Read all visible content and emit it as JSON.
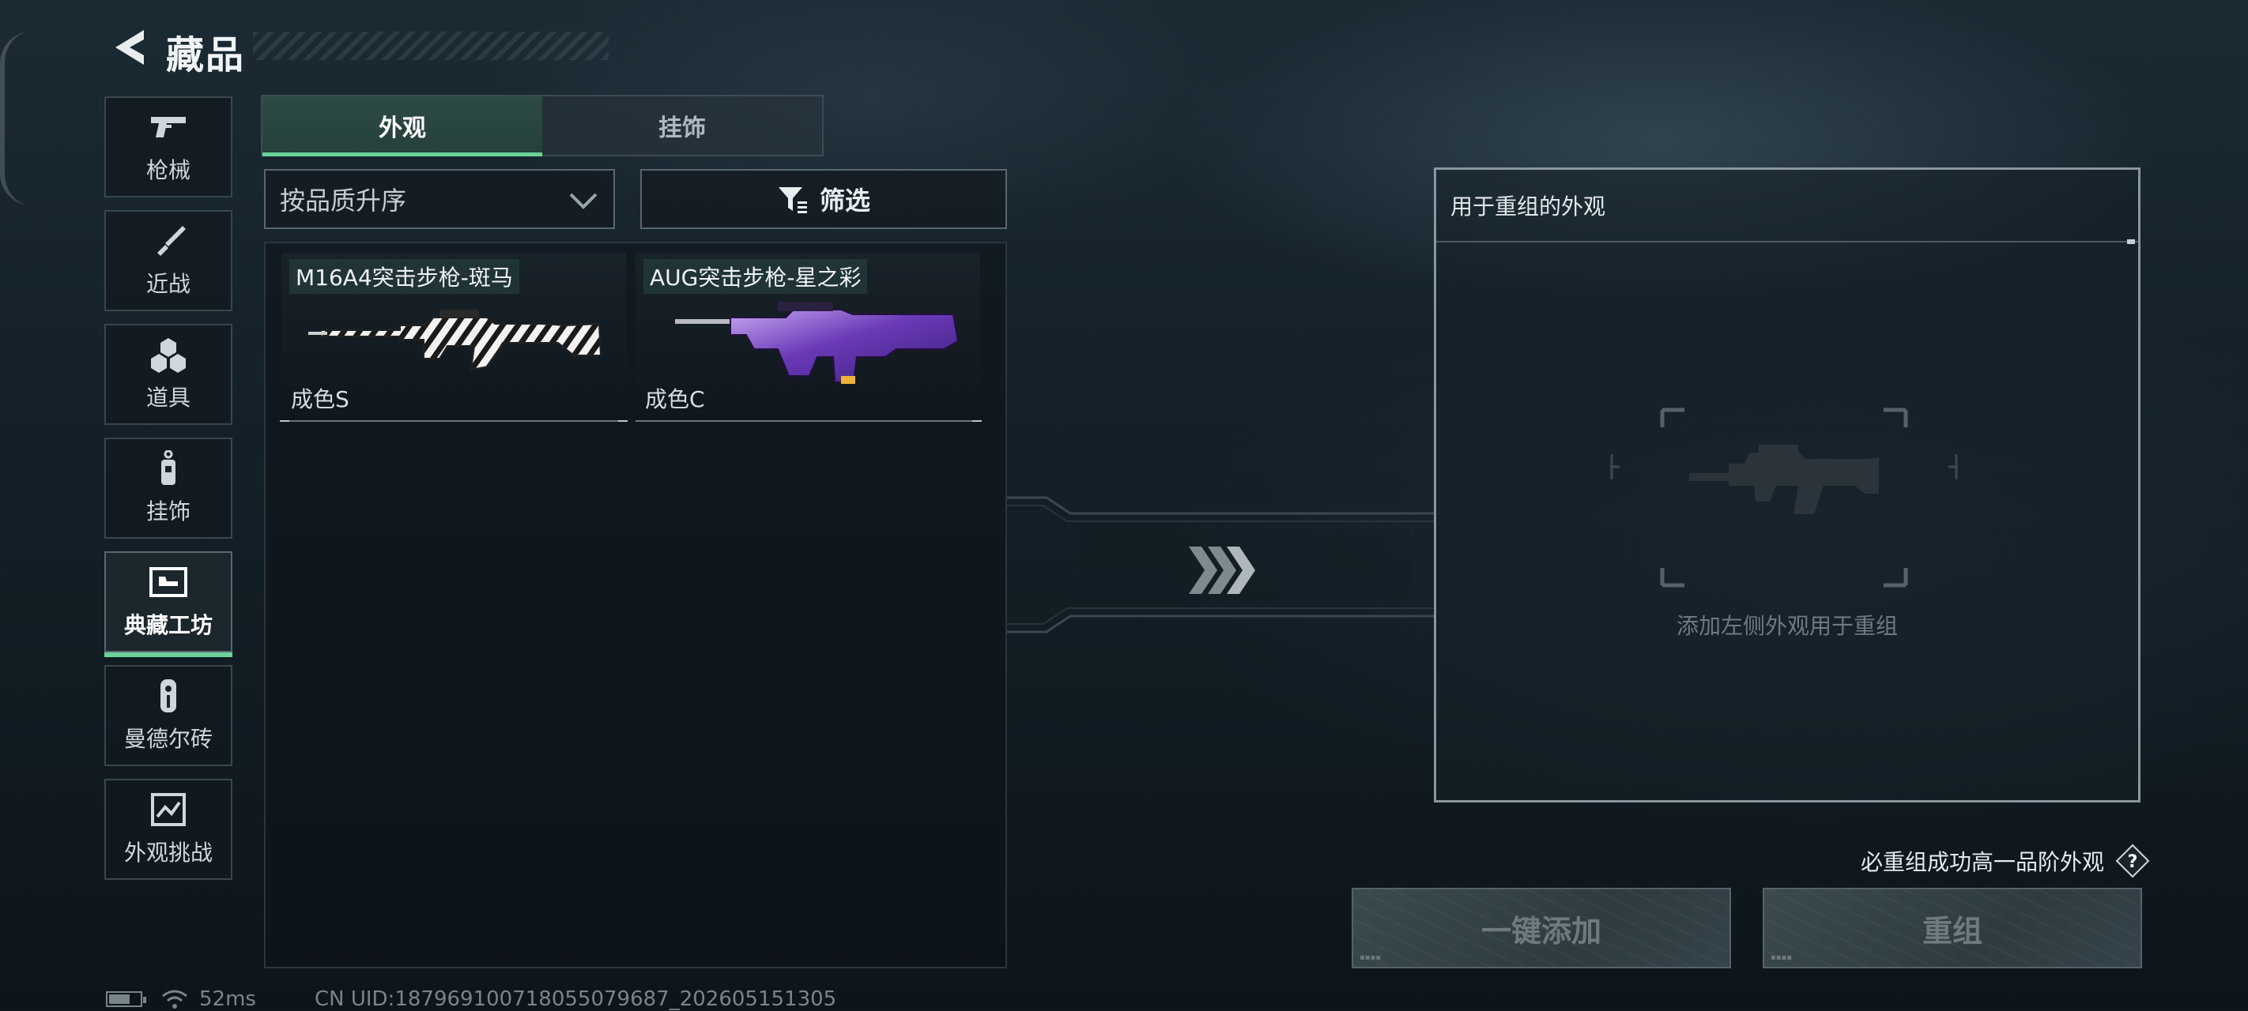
{
  "header": {
    "title": "藏品"
  },
  "sidebar": {
    "items": [
      {
        "label": "枪械",
        "icon": "pistol-icon",
        "active": false
      },
      {
        "label": "近战",
        "icon": "knife-icon",
        "active": false
      },
      {
        "label": "道具",
        "icon": "grenade-icon",
        "active": false
      },
      {
        "label": "挂饰",
        "icon": "charm-icon",
        "active": false
      },
      {
        "label": "典藏工坊",
        "icon": "workshop-icon",
        "active": true
      },
      {
        "label": "曼德尔砖",
        "icon": "brick-icon",
        "active": false
      },
      {
        "label": "外观挑战",
        "icon": "challenge-icon",
        "active": false
      }
    ]
  },
  "tabs": [
    {
      "label": "外观",
      "active": true
    },
    {
      "label": "挂饰",
      "active": false
    }
  ],
  "sort": {
    "selected": "按品质升序"
  },
  "filter": {
    "label": "筛选"
  },
  "inventory": {
    "items": [
      {
        "name": "M16A4突击步枪-斑马",
        "grade": "成色S"
      },
      {
        "name": "AUG突击步枪-星之彩",
        "grade": "成色C"
      }
    ]
  },
  "recombine": {
    "title": "用于重组的外观",
    "placeholder": "添加左侧外观用于重组"
  },
  "hint": {
    "text": "必重组成功高一品阶外观",
    "help": "?"
  },
  "buttons": {
    "add_all": "一键添加",
    "recombine": "重组"
  },
  "status": {
    "ping": "52ms",
    "uid": "CN UID:187969100718055079687_202605151305"
  },
  "colors": {
    "accent": "#6bd39a",
    "panel_border": "#8a969d",
    "background": "#15222a"
  }
}
